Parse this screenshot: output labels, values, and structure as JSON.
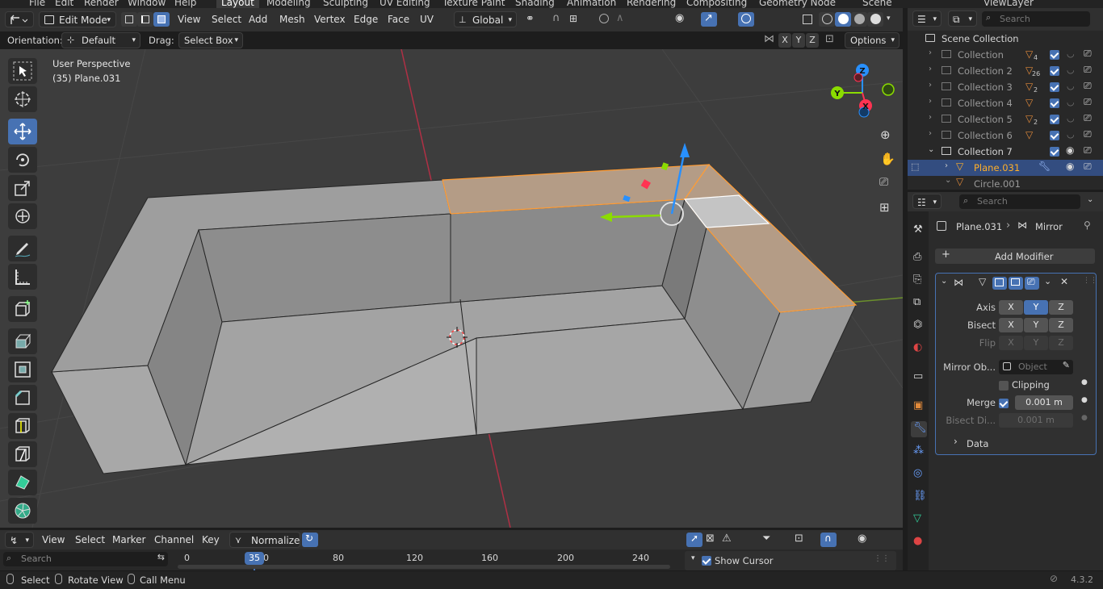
{
  "top_menu": [
    "File",
    "Edit",
    "Render",
    "Window",
    "Help"
  ],
  "workspaces": [
    "Layout",
    "Modeling",
    "Sculpting",
    "UV Editing",
    "Texture Paint",
    "Shading",
    "Animation",
    "Rendering",
    "Compositing",
    "Geometry Node"
  ],
  "scene_name": "Scene",
  "view_layer": "ViewLayer",
  "viewport_header": {
    "mode": "Edit Mode",
    "menus": [
      "View",
      "Select",
      "Add",
      "Mesh",
      "Vertex",
      "Edge",
      "Face",
      "UV"
    ],
    "transform_orientation": "Global"
  },
  "tool_settings": {
    "orientation_label": "Orientation:",
    "orientation_value": "Default",
    "drag_label": "Drag:",
    "drag_value": "Select Box",
    "axis_x": "X",
    "axis_y": "Y",
    "axis_z": "Z",
    "options": "Options"
  },
  "viewport_overlay": {
    "perspective": "User Perspective",
    "object_info": "(35) Plane.031"
  },
  "gizmo_axes": {
    "x": "X",
    "y": "Y",
    "z": "Z"
  },
  "outliner": {
    "search_placeholder": "Search",
    "root": "Scene Collection",
    "items": [
      {
        "name": "Collection",
        "count": "4"
      },
      {
        "name": "Collection 2",
        "count": "26"
      },
      {
        "name": "Collection 3",
        "count": "2"
      },
      {
        "name": "Collection 4",
        "count": ""
      },
      {
        "name": "Collection 5",
        "count": "2"
      },
      {
        "name": "Collection 6",
        "count": ""
      },
      {
        "name": "Collection 7",
        "count": ""
      },
      {
        "name": "Plane.031",
        "count": ""
      },
      {
        "name": "Circle.001",
        "count": ""
      }
    ]
  },
  "properties": {
    "search_placeholder": "Search",
    "breadcrumb_object": "Plane.031",
    "breadcrumb_modifier": "Mirror",
    "add_modifier": "Add Modifier",
    "axis_label": "Axis",
    "bisect_label": "Bisect",
    "flip_label": "Flip",
    "mirror_object_label": "Mirror Ob...",
    "mirror_object_placeholder": "Object",
    "clipping_label": "Clipping",
    "merge_label": "Merge",
    "merge_value": "0.001 m",
    "bisect_distance_label": "Bisect Di...",
    "bisect_distance_value": "0.001 m",
    "data_panel": "Data",
    "x": "X",
    "y": "Y",
    "z": "Z"
  },
  "timeline_header": {
    "menus": [
      "View",
      "Select",
      "Marker",
      "Channel",
      "Key"
    ],
    "normalize": "Normalize",
    "show_cursor": "Show Cursor"
  },
  "timeline": {
    "search_placeholder": "Search",
    "current_frame": "35",
    "ticks": [
      "0",
      "0",
      "80",
      "120",
      "160",
      "200",
      "240"
    ]
  },
  "statusbar": {
    "select": "Select",
    "rotate_view": "Rotate View",
    "call_menu": "Call Menu",
    "version": "4.3.2"
  },
  "colors": {
    "selection_orange": "#ff9c35",
    "active_blue": "#4772b3",
    "axis_red": "#ff3352",
    "axis_green": "#8bdc00",
    "axis_blue": "#2890ff"
  }
}
